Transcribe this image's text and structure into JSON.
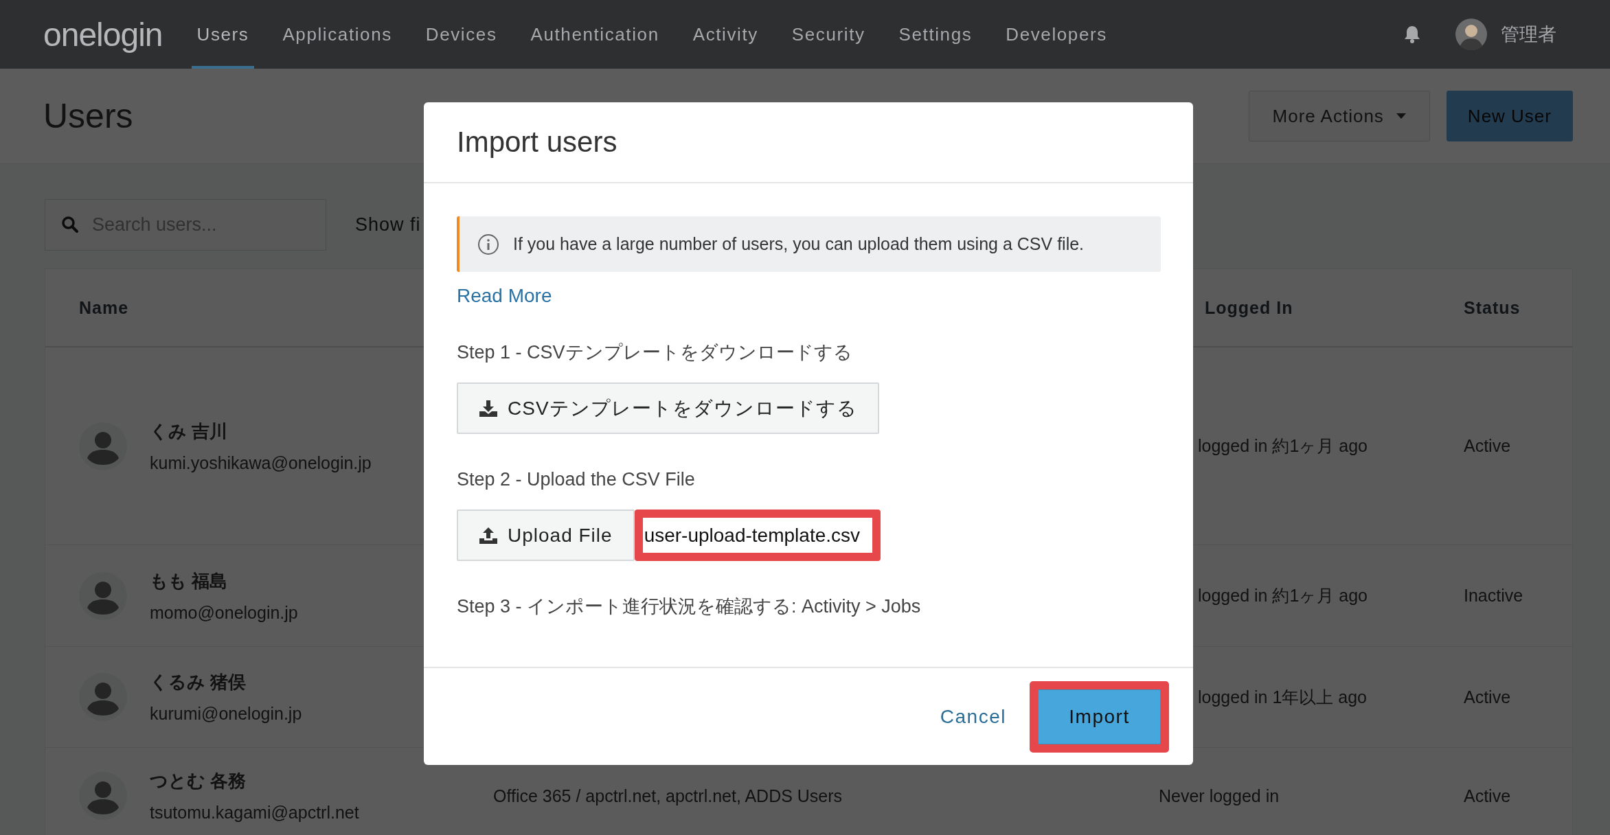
{
  "nav": {
    "logo": "onelogin",
    "items": [
      {
        "label": "Users",
        "selected": true
      },
      {
        "label": "Applications",
        "selected": false
      },
      {
        "label": "Devices",
        "selected": false
      },
      {
        "label": "Authentication",
        "selected": false
      },
      {
        "label": "Activity",
        "selected": false
      },
      {
        "label": "Security",
        "selected": false
      },
      {
        "label": "Settings",
        "selected": false
      },
      {
        "label": "Developers",
        "selected": false
      }
    ],
    "user": "管理者"
  },
  "page": {
    "title": "Users",
    "buttons": [
      {
        "label": "More Actions",
        "kind": "dropdown"
      },
      {
        "label": "New User",
        "kind": "primary"
      }
    ]
  },
  "search": {
    "placeholder": "Search users..."
  },
  "filter_label": "Show fi",
  "table": {
    "columns": [
      {
        "label": "Name"
      },
      {
        "label": "Logged In"
      },
      {
        "label": "Status"
      }
    ],
    "rows": [
      {
        "name": "くみ 吉川",
        "email": "kumi.yoshikawa@onelogin.jp",
        "last_login": "logged in 約1ヶ月 ago",
        "status": "Active"
      },
      {
        "name": "もも 福島",
        "email": "momo@onelogin.jp",
        "last_login": "logged in 約1ヶ月 ago",
        "status": "Inactive"
      },
      {
        "name": "くるみ 猪俣",
        "email": "kurumi@onelogin.jp",
        "last_login": "logged in 1年以上 ago",
        "status": "Active"
      },
      {
        "name": "つとむ 各務",
        "email": "tsutomu.kagami@apctrl.net",
        "apps": "Office 365 / apctrl.net, apctrl.net, ADDS Users",
        "last_login": "Never logged in",
        "status": "Active"
      }
    ]
  },
  "modal": {
    "title": "Import users",
    "info": "If you have a large number of users, you can upload them using a CSV file.",
    "read_more": "Read More",
    "steps": [
      {
        "kind": "download",
        "label": "Step 1 - CSVテンプレートをダウンロードする",
        "button": "CSVテンプレートをダウンロードする"
      },
      {
        "kind": "upload",
        "label": "Step 2 - Upload the CSV File",
        "button": "Upload File",
        "file": {
          "value": "user-upload-template.csv",
          "highlighted": true
        }
      },
      {
        "kind": "text",
        "label": "Step 3 - インポート進行状況を確認する: Activity > Jobs"
      }
    ],
    "cancel": {
      "label": "Cancel",
      "highlighted": false
    },
    "submit": {
      "label": "Import",
      "highlighted": true
    }
  }
}
